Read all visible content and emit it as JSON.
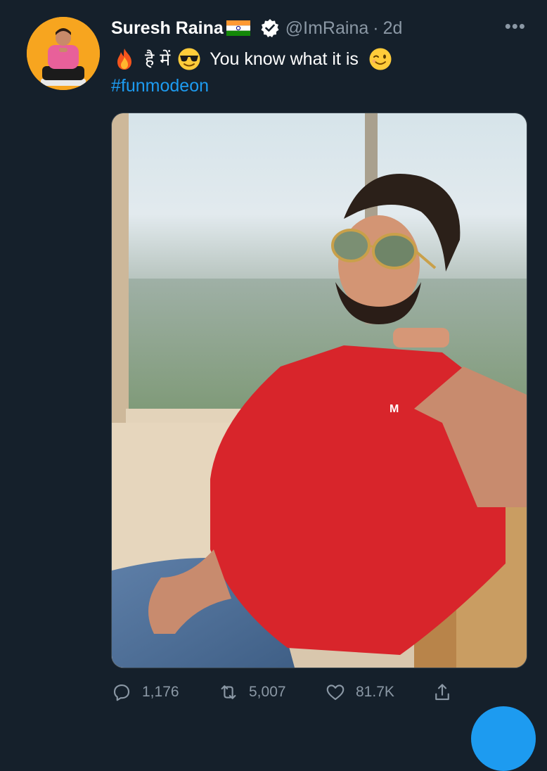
{
  "tweet": {
    "author_name": "Suresh Raina",
    "handle": "@ImRaina",
    "separator": "·",
    "time": "2d",
    "more_label": "•••",
    "text_hindi": "है में",
    "text_english": "You know what it is",
    "hashtag": "#funmodeon",
    "stats": {
      "replies": "1,176",
      "retweets": "5,007",
      "likes": "81.7K"
    }
  },
  "icons": {
    "verified": "verified-badge-icon",
    "flag": "india-flag-icon",
    "reply": "reply-icon",
    "retweet": "retweet-icon",
    "like": "heart-icon",
    "share": "share-icon"
  },
  "colors": {
    "background": "#15202b",
    "text": "#ffffff",
    "muted": "#8b98a5",
    "accent": "#1d9bf0"
  }
}
